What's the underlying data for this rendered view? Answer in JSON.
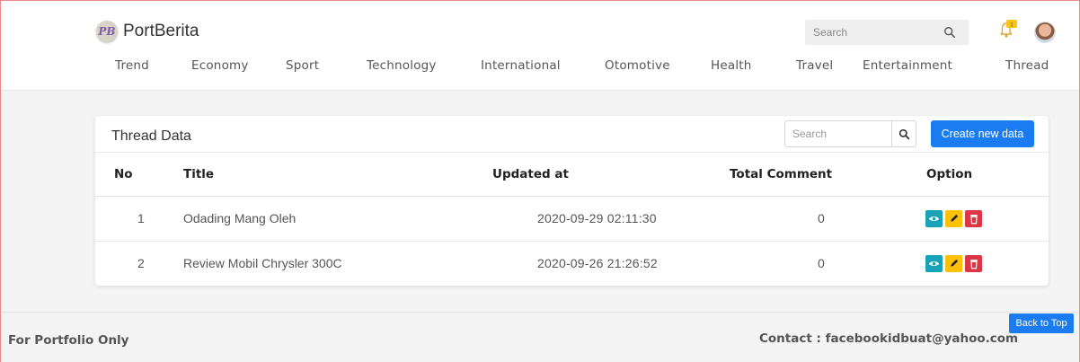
{
  "brand": {
    "logo_text": "PB",
    "name": "PortBerita"
  },
  "header": {
    "search_placeholder": "Search",
    "notification_badge": "1"
  },
  "nav": [
    "Trend",
    "Economy",
    "Sport",
    "Technology",
    "International",
    "Otomotive",
    "Health",
    "Travel",
    "Entertainment",
    "Thread"
  ],
  "card": {
    "title": "Thread Data",
    "search_placeholder": "Search",
    "create_label": "Create new data",
    "columns": [
      "No",
      "Title",
      "Updated at",
      "Total Comment",
      "Option"
    ],
    "rows": [
      {
        "no": "1",
        "title": "Odading Mang Oleh",
        "updated_at": "2020-09-29 02:11:30",
        "total_comment": "0"
      },
      {
        "no": "2",
        "title": "Review Mobil Chrysler 300C",
        "updated_at": "2020-09-26 21:26:52",
        "total_comment": "0"
      }
    ]
  },
  "footer": {
    "left": "For Portfolio Only",
    "right": "Contact : facebookidbuat@yahoo.com",
    "back_to_top": "Back to Top"
  },
  "colors": {
    "primary": "#1a7cf0",
    "view": "#17a2b8",
    "edit": "#ffc107",
    "delete": "#dc3545"
  }
}
